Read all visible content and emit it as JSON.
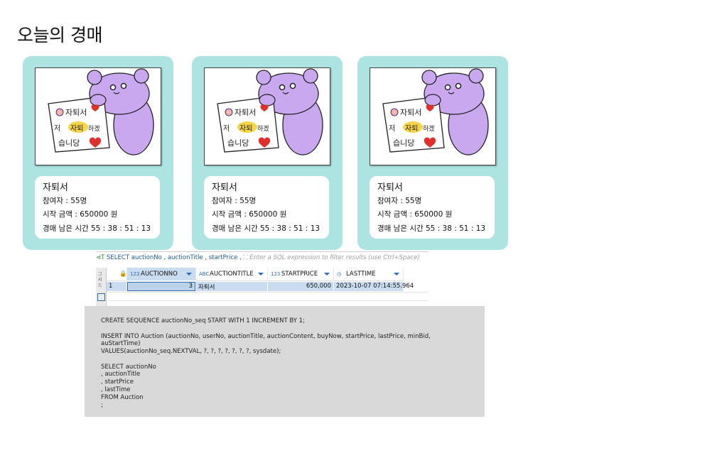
{
  "page": {
    "title": "오늘의 경매"
  },
  "cards": [
    {
      "title": "자퇴서",
      "participants": "참여자 : 55명",
      "start_price": "시작 금액 : 650000 원",
      "time_left": "경매 남은 시간 55 : 38 : 51 : 13"
    },
    {
      "title": "자퇴서",
      "participants": "참여자 : 55명",
      "start_price": "시작 금액 : 650000 원",
      "time_left": "경매 남은 시간 55 : 38 : 51 : 13"
    },
    {
      "title": "자퇴서",
      "participants": "참여자 : 55명",
      "start_price": "시작 금액 : 650000 원",
      "time_left": "경매 남은 시간 55 : 38 : 51 : 13"
    }
  ],
  "card_image": {
    "line1": "자퇴서",
    "line2_a": "저",
    "line2_b": "자퇴",
    "line2_c": "하겠",
    "line3": "습니당"
  },
  "db_grid": {
    "filter_query": "SELECT auctionNo , auctionTitle , startPrice ,",
    "filter_placeholder": "Enter a SQL expression to filter results (use Ctrl+Space)",
    "side_tab": "그리드",
    "columns": [
      {
        "type": "123",
        "name": "AUCTIONNO"
      },
      {
        "type": "ABC",
        "name": "AUCTIONTITLE"
      },
      {
        "type": "123",
        "name": "STARTPRICE"
      },
      {
        "type": "◷",
        "name": "LASTTIME"
      }
    ],
    "row": {
      "rownum": "1",
      "auctionno": "3",
      "auctiontitle": "자퇴서",
      "startprice": "650,000",
      "lasttime": "2023-10-07 07:14:55.964"
    }
  },
  "code_lines": [
    "CREATE SEQUENCE auctionNo_seq START WITH 1 INCREMENT BY 1;",
    "INSERT INTO Auction (auctionNo, userNo, auctionTitle, auctionContent, buyNow, startPrice, lastPrice, minBid,",
    "auStartTime)",
    "VALUES(auctionNo_seq.NEXTVAL, ?, ?, ?, ?, ?, ?, ?, sysdate);",
    "SELECT auctionNo",
    ", auctionTitle",
    ", startPrice",
    ", lastTime",
    "FROM Auction",
    ";"
  ]
}
